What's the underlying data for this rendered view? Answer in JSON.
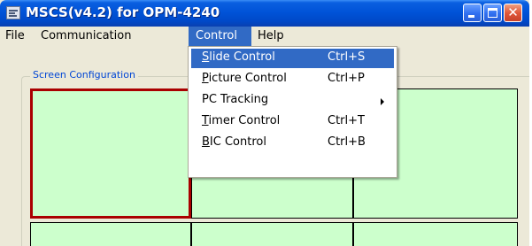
{
  "window": {
    "title": "MSCS(v4.2) for OPM-4240"
  },
  "menubar": {
    "items": [
      {
        "label": "File"
      },
      {
        "label": "Communication"
      },
      {
        "label": "Control"
      },
      {
        "label": "Help"
      }
    ]
  },
  "screen_config": {
    "label": "Screen Configuration",
    "cell_color": "#ccffcc",
    "selected_border_color": "#aa0000"
  },
  "control_menu": {
    "items": [
      {
        "first": "S",
        "rest": "lide Control",
        "shortcut": "Ctrl+S"
      },
      {
        "first": "P",
        "rest": "icture Control",
        "shortcut": "Ctrl+P"
      },
      {
        "label": "PC Tracking"
      },
      {
        "first": "T",
        "rest": "imer Control",
        "shortcut": "Ctrl+T"
      },
      {
        "first": "B",
        "rest": "IC Control",
        "shortcut": "Ctrl+B"
      }
    ]
  },
  "colors": {
    "titlebar": "#0053d8",
    "menu_highlight": "#316ac5"
  }
}
